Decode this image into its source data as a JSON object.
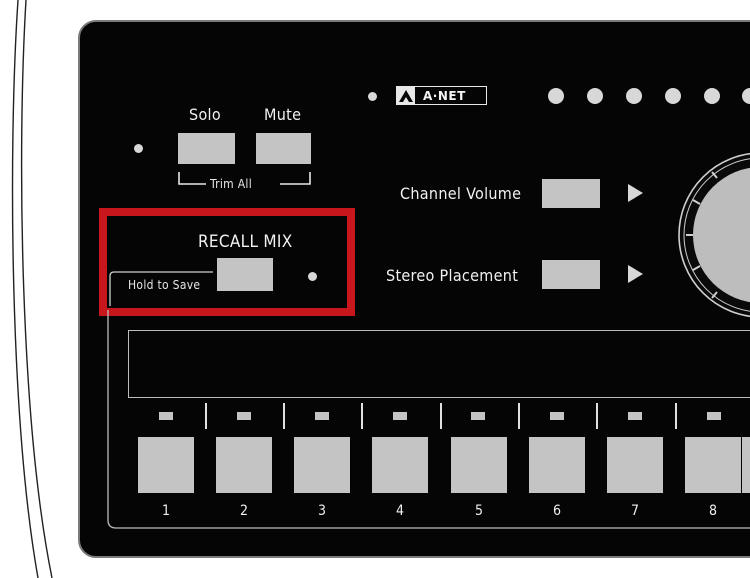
{
  "colors": {
    "panel": "#050505",
    "button": "#c4c4c4",
    "highlight": "#c8161d",
    "text": "#f2f2f2"
  },
  "brand": {
    "logo_text": "A·NET",
    "logo_icon": "anet-logo-icon"
  },
  "solo": {
    "label": "Solo"
  },
  "mute": {
    "label": "Mute"
  },
  "trim_all": {
    "label": "Trim All"
  },
  "recall_mix": {
    "label": "RECALL MIX",
    "sub_label": "Hold to Save"
  },
  "controls": {
    "channel_volume": "Channel Volume",
    "stereo_placement": "Stereo Placement"
  },
  "channels": [
    {
      "label": "1"
    },
    {
      "label": "2"
    },
    {
      "label": "3"
    },
    {
      "label": "4"
    },
    {
      "label": "5"
    },
    {
      "label": "6"
    },
    {
      "label": "7"
    },
    {
      "label": "8"
    }
  ],
  "icons": {
    "arrow": "play-arrow-icon",
    "knob": "rotary-knob-icon",
    "led": "led-indicator-icon"
  }
}
